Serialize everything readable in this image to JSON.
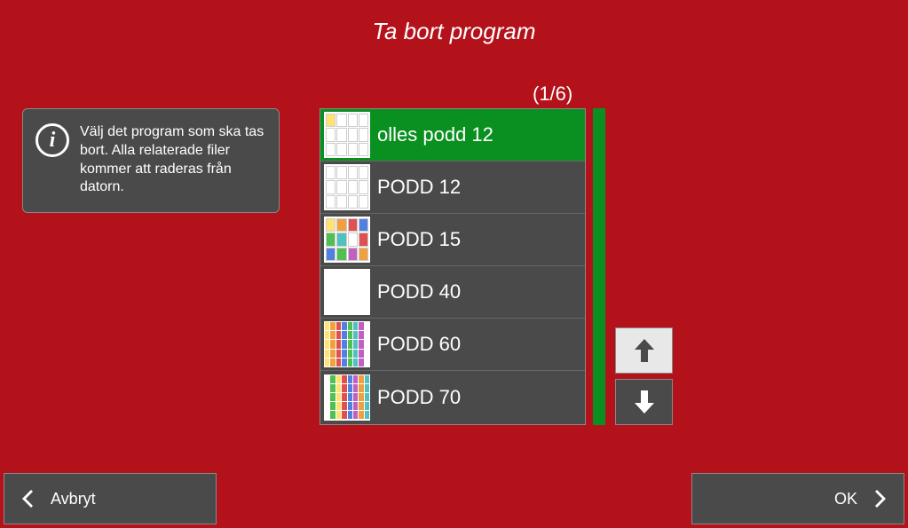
{
  "title": "Ta bort program",
  "info_text": "Välj det program som ska tas bort. Alla relaterade filer kommer att raderas från datorn.",
  "pagination": "(1/6)",
  "items": [
    {
      "label": "olles podd 12",
      "selected": true,
      "thumb_style": "grid12a"
    },
    {
      "label": "PODD 12",
      "selected": false,
      "thumb_style": "grid12b"
    },
    {
      "label": "PODD 15",
      "selected": false,
      "thumb_style": "color15"
    },
    {
      "label": "PODD 40",
      "selected": false,
      "thumb_style": "grid40"
    },
    {
      "label": "PODD 60",
      "selected": false,
      "thumb_style": "color60"
    },
    {
      "label": "PODD 70",
      "selected": false,
      "thumb_style": "color70"
    }
  ],
  "buttons": {
    "cancel": "Avbryt",
    "ok": "OK"
  }
}
